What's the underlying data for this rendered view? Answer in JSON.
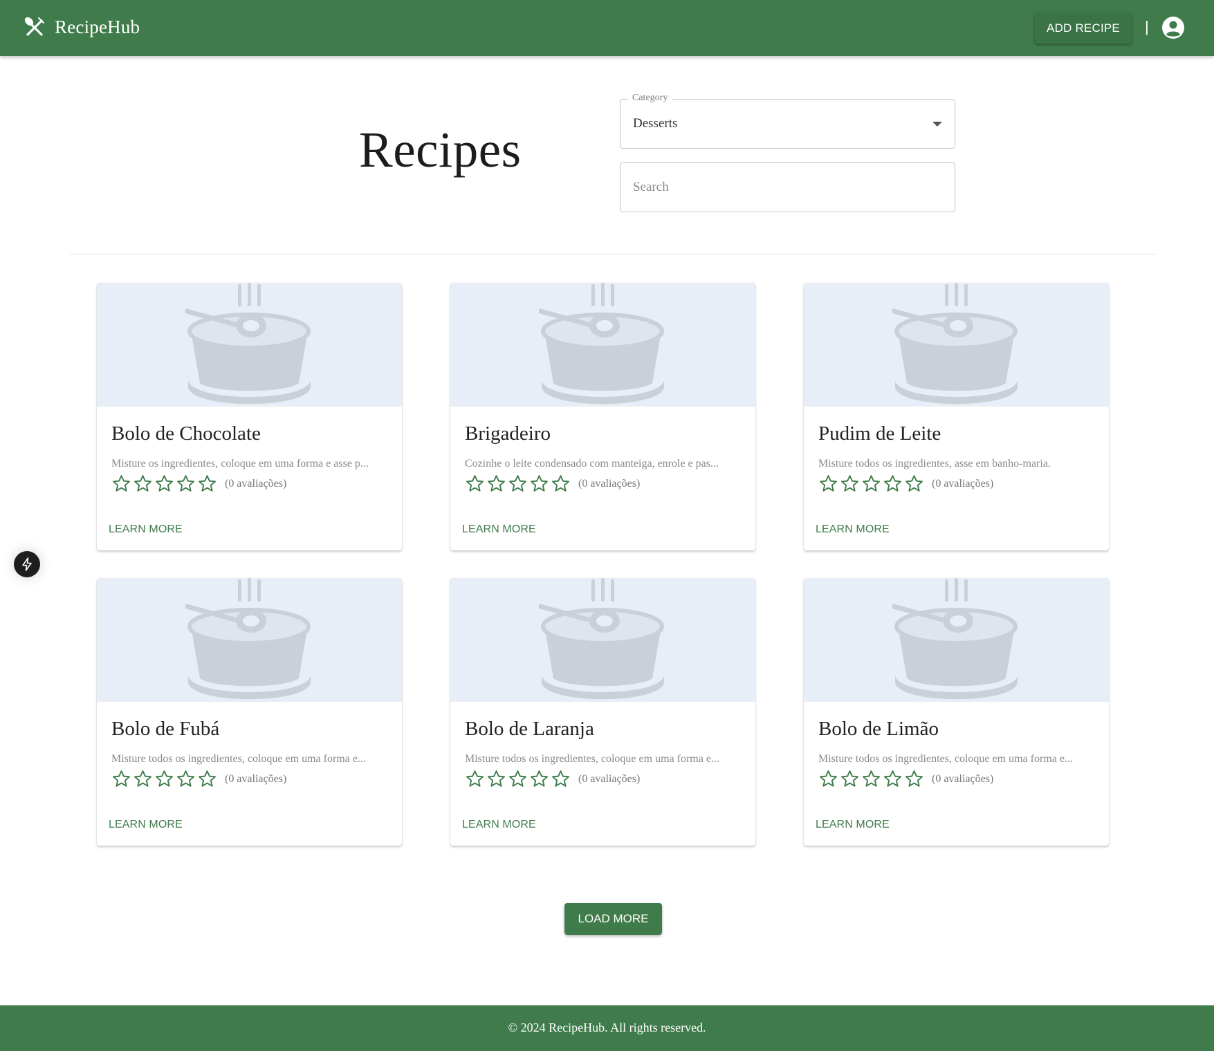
{
  "header": {
    "brand_name": "RecipeHub",
    "brand_icon": "fork-knife-icon",
    "add_recipe_label": "ADD RECIPE",
    "separator": "|",
    "account_icon": "account-circle-icon"
  },
  "main": {
    "title": "Recipes",
    "category": {
      "label": "Category",
      "selected": "Desserts"
    },
    "search": {
      "placeholder": "Search",
      "value": ""
    },
    "learn_more_label": "LEARN MORE",
    "load_more_label": "LOAD MORE"
  },
  "recipes": [
    {
      "title": "Bolo de Chocolate",
      "description": "Misture os ingredientes, coloque em uma forma e asse p...",
      "rating": 0,
      "reviews": "(0 avaliações)"
    },
    {
      "title": "Brigadeiro",
      "description": "Cozinhe o leite condensado com manteiga, enrole e pas...",
      "rating": 0,
      "reviews": "(0 avaliações)"
    },
    {
      "title": "Pudim de Leite",
      "description": "Misture todos os ingredientes, asse em banho-maria.",
      "rating": 0,
      "reviews": "(0 avaliações)"
    },
    {
      "title": "Bolo de Fubá",
      "description": "Misture todos os ingredientes, coloque em uma forma e...",
      "rating": 0,
      "reviews": "(0 avaliações)"
    },
    {
      "title": "Bolo de Laranja",
      "description": "Misture todos os ingredientes, coloque em uma forma e...",
      "rating": 0,
      "reviews": "(0 avaliações)"
    },
    {
      "title": "Bolo de Limão",
      "description": "Misture todos os ingredientes, coloque em uma forma e...",
      "rating": 0,
      "reviews": "(0 avaliações)"
    }
  ],
  "footer": {
    "text": "© 2024 RecipeHub. All rights reserved."
  },
  "colors": {
    "primary": "#407c4b",
    "media_background": "#e8eef7",
    "placeholder_icon": "#c9d0d8"
  },
  "floating_button": {
    "icon": "bolt-icon"
  }
}
